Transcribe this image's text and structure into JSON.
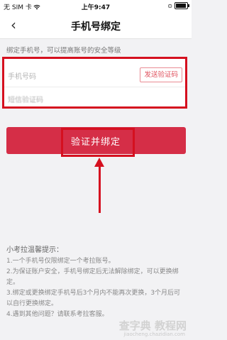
{
  "status_bar": {
    "carrier": "无 SIM 卡",
    "time": "上午9:47",
    "battery_level_percent": 90
  },
  "nav": {
    "title": "手机号绑定"
  },
  "form": {
    "hint": "绑定手机号，可以提高账号的安全等级",
    "phone_placeholder": "手机号码",
    "send_code_label": "发送验证码",
    "sms_code_placeholder": "短信验证码"
  },
  "bind_button_label": "验证并绑定",
  "tips": {
    "title": "小考拉温馨提示：",
    "items": [
      "1.一个手机号仅限绑定一个考拉账号。",
      "2.为保证账户安全，手机号绑定后无法解除绑定，可以更换绑定。",
      "3.绑定或更换绑定手机号后3个月内不能再次更换，3个月后可以自行更换绑定。",
      "4.遇到其他问题？请联系考拉客服。"
    ]
  },
  "watermark": {
    "text": "查字典 教程网",
    "url": "jiaocheng.chazidian.com"
  },
  "colors": {
    "accent": "#d52e47",
    "annotation_red": "#d5101f",
    "background": "#f2f2f4"
  }
}
